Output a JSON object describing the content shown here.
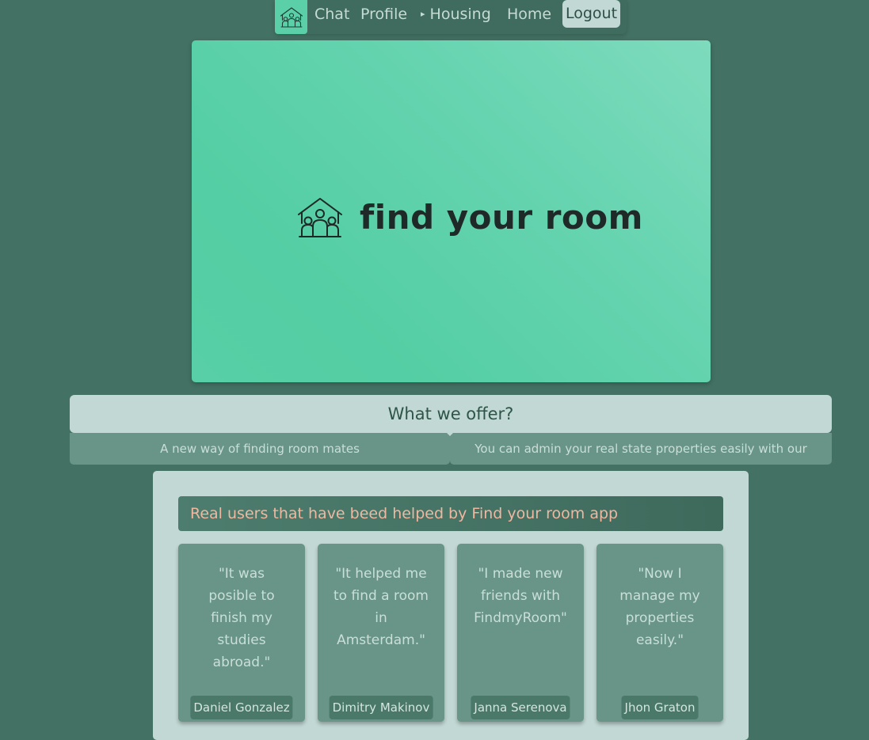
{
  "nav": {
    "logo_icon": "house-people-icon",
    "items": [
      {
        "label": "Chat"
      },
      {
        "label": "Profile"
      },
      {
        "label": "Housing",
        "arrow": "▸"
      },
      {
        "label": "Home"
      }
    ],
    "logout_label": "Logout"
  },
  "hero": {
    "logo_icon": "house-people-icon",
    "title": "find your room"
  },
  "offer": {
    "heading": "What we offer?",
    "items": [
      {
        "text": "A new way of finding room mates"
      },
      {
        "text": "You can admin your real state properties easily with our solution"
      }
    ]
  },
  "testimonials": {
    "heading": "Real users that have beed helped by Find your room app",
    "cards": [
      {
        "quote": "\"It was posible to finish my studies abroad.\"",
        "name": "Daniel Gonzalez"
      },
      {
        "quote": "\"It helped me to find a room in Amsterdam.\"",
        "name": "Dimitry Makinov"
      },
      {
        "quote": "\"I made new friends with FindmyRoom\"",
        "name": "Janna Serenova"
      },
      {
        "quote": "\"Now I manage my properties easily.\"",
        "name": "Jhon Graton"
      }
    ]
  },
  "colors": {
    "background": "#437163",
    "accent": "#5bcfa8",
    "panel": "#c2d8d4",
    "card": "#699488",
    "heading_text": "#f0b7a0"
  }
}
